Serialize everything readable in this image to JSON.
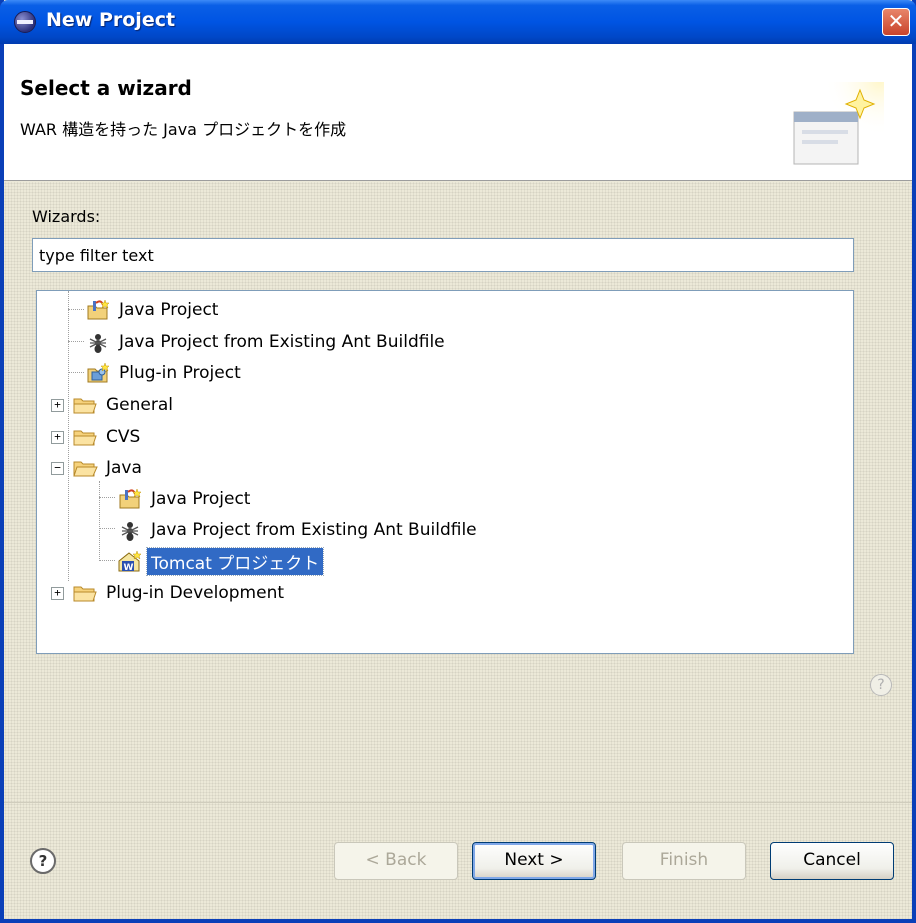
{
  "window": {
    "title": "New Project",
    "close_symbol": "✕"
  },
  "header": {
    "title": "Select a wizard",
    "description": "WAR 構造を持った Java プロジェクトを作成"
  },
  "wizards_label": "Wizards:",
  "filter": {
    "value": "type filter text"
  },
  "tree": {
    "items": [
      {
        "label": "Java Project",
        "icon": "java-project-icon"
      },
      {
        "label": "Java Project from Existing Ant Buildfile",
        "icon": "ant-icon"
      },
      {
        "label": "Plug-in Project",
        "icon": "plugin-project-icon"
      },
      {
        "label": "General",
        "icon": "folder-icon",
        "expander": "+"
      },
      {
        "label": "CVS",
        "icon": "folder-icon",
        "expander": "+"
      },
      {
        "label": "Java",
        "icon": "folder-open-icon",
        "expander": "−"
      },
      {
        "label": "Java Project",
        "icon": "java-project-icon"
      },
      {
        "label": "Java Project from Existing Ant Buildfile",
        "icon": "ant-icon"
      },
      {
        "label": "Tomcat プロジェクト",
        "icon": "tomcat-project-icon",
        "selected": true
      },
      {
        "label": "Plug-in Development",
        "icon": "folder-icon",
        "expander": "+"
      }
    ]
  },
  "help": {
    "symbol": "?"
  },
  "buttons": {
    "back": "< Back",
    "next": "Next >",
    "finish": "Finish",
    "cancel": "Cancel"
  },
  "colors": {
    "titlebar": "#0054e3",
    "dialog_bg": "#ece9d8",
    "selection": "#316ac5"
  }
}
